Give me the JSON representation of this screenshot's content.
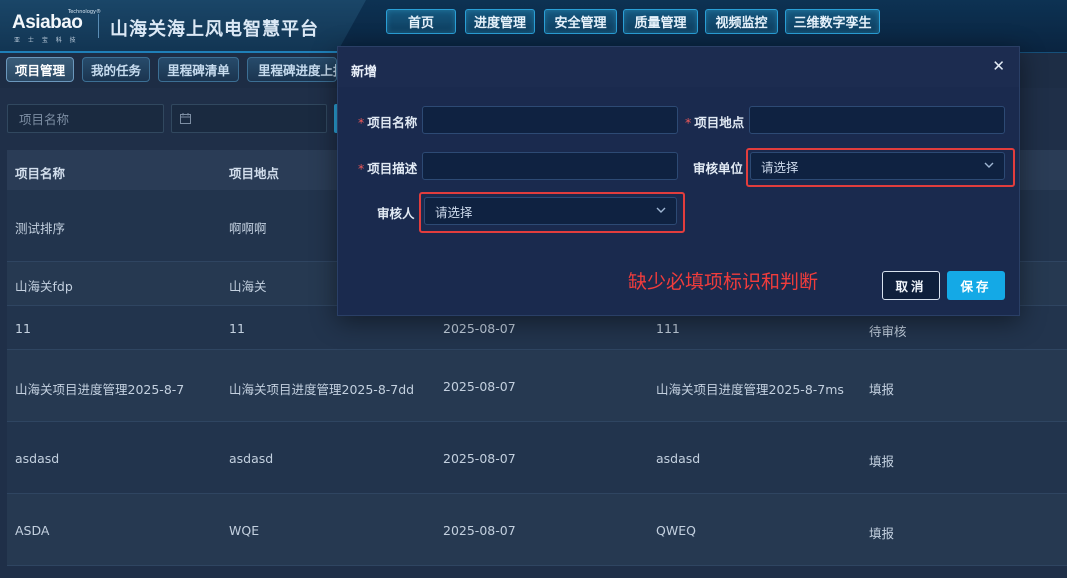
{
  "header": {
    "logo": {
      "small_text": "Technology®",
      "main_text": "Asiabao",
      "sub_text": "亚 士 宝 科 技"
    },
    "app_title": "山海关海上风电智慧平台",
    "nav": [
      "首页",
      "进度管理",
      "安全管理",
      "质量管理",
      "视频监控",
      "三维数字孪生"
    ]
  },
  "sub_tabs": [
    "项目管理",
    "我的任务",
    "里程碑清单",
    "里程碑进度上报"
  ],
  "filters": {
    "project_name_placeholder": "项目名称",
    "date_icon": "calendar-icon"
  },
  "table": {
    "columns": [
      "项目名称",
      "项目地点"
    ],
    "rows": [
      [
        "测试排序",
        "啊啊啊",
        "",
        "",
        ""
      ],
      [
        "山海关fdp",
        "山海关",
        "",
        "",
        ""
      ],
      [
        "11",
        "11",
        "2025-08-07",
        "111",
        "待审核"
      ],
      [
        "山海关项目进度管理2025-8-7",
        "山海关项目进度管理2025-8-7dd",
        "2025-08-07",
        "山海关项目进度管理2025-8-7ms",
        "填报"
      ],
      [
        "asdasd",
        "asdasd",
        "2025-08-07",
        "asdasd",
        "填报"
      ],
      [
        "ASDA",
        "WQE",
        "2025-08-07",
        "QWEQ",
        "填报"
      ]
    ]
  },
  "dialog": {
    "title": "新增",
    "close_icon": "close-icon",
    "required_mark": "*",
    "labels": {
      "project_name": "项目名称",
      "project_location": "项目地点",
      "project_desc": "项目描述",
      "review_unit": "审核单位",
      "reviewer": "审核人"
    },
    "values": {
      "project_name": "",
      "project_location": "",
      "project_desc": "",
      "review_unit": "请选择",
      "reviewer": "请选择"
    },
    "annotation": "缺少必填项标识和判断",
    "buttons": {
      "cancel": "取消",
      "save": "保存"
    }
  },
  "colors": {
    "accent": "#14a9e6",
    "annotation": "#e23d3d",
    "dialog_bg": "#1a2a4e"
  }
}
